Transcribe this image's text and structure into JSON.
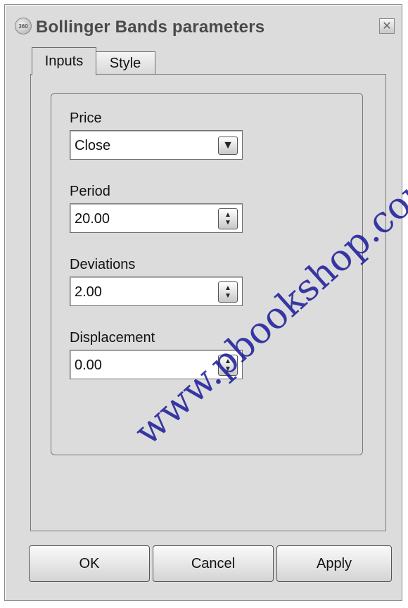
{
  "window": {
    "title": "Bollinger Bands parameters",
    "close_glyph": "✕"
  },
  "tabs": [
    {
      "label": "Inputs",
      "selected": true
    },
    {
      "label": "Style",
      "selected": false
    }
  ],
  "fields": {
    "price": {
      "label": "Price",
      "value": "Close",
      "control": "dropdown"
    },
    "period": {
      "label": "Period",
      "value": "20.00",
      "control": "spinner"
    },
    "deviations": {
      "label": "Deviations",
      "value": "2.00",
      "control": "spinner"
    },
    "displacement": {
      "label": "Displacement",
      "value": "0.00",
      "control": "spinner"
    }
  },
  "buttons": {
    "ok": "OK",
    "cancel": "Cancel",
    "apply": "Apply"
  },
  "watermark": "www.pbookshop.com",
  "icons": {
    "app": "app-logo-icon",
    "dropdown": "chevron-down-icon",
    "spinner": "spin-updown-icon",
    "close": "close-icon"
  }
}
